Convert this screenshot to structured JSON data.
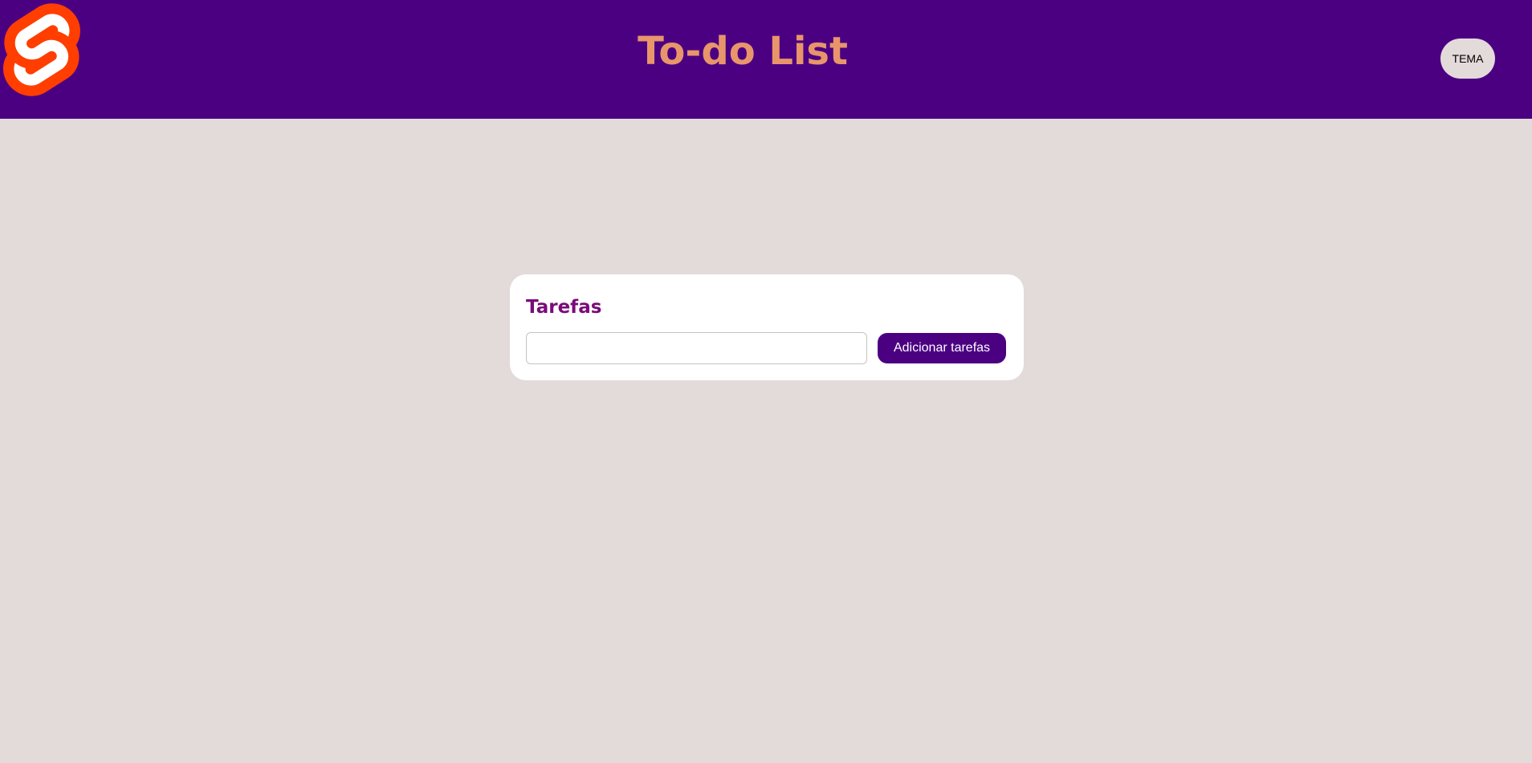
{
  "header": {
    "logo_icon": "svelte-logo-icon",
    "title": "To-do List",
    "theme_button_label": "TEMA"
  },
  "tasks": {
    "title": "Tarefas",
    "input_value": "",
    "input_placeholder": "",
    "add_button_label": "Adicionar tarefas"
  },
  "colors": {
    "header_bg": "#4b0082",
    "page_bg": "#e3dada",
    "title_color": "#e8956b",
    "card_title_color": "#7a0a7a",
    "button_bg": "#4b0082",
    "logo_color": "#ff3e00"
  }
}
